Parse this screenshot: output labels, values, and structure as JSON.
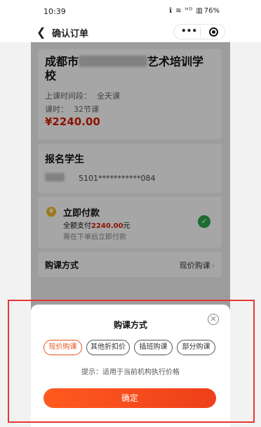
{
  "status_bar": {
    "time": "10:39",
    "icons": "ℹ ≋ ᴴᴰ ▥",
    "battery": "76%"
  },
  "nav": {
    "title": "确认订单",
    "more_icon": "more-icon",
    "target_icon": "target-icon"
  },
  "order": {
    "school_name_prefix": "成都市",
    "school_name_suffix": "艺术培训学校",
    "time_label": "上课时间段：",
    "time_value": "全天课",
    "hours_label": "课时：",
    "hours_value": "32节课",
    "price": "¥2240.00"
  },
  "student": {
    "section_title": "报名学生",
    "id_number": "5101***********084"
  },
  "payment": {
    "title": "立即付款",
    "line_prefix": "全额支付",
    "amount": "2240.00",
    "unit": "元",
    "note": "需在下单后立即付款"
  },
  "purchase": {
    "label": "购课方式",
    "value": "现价购课"
  },
  "sheet": {
    "title": "购课方式",
    "options": [
      "现价购课",
      "其他折扣价",
      "插班购课",
      "部分购课"
    ],
    "hint": "提示：适用于当前机构执行价格",
    "confirm_label": "确定"
  },
  "colors": {
    "accent": "#e8541c",
    "price_red": "#d81e06",
    "success_green": "#2aa84a",
    "highlight_frame": "#e53935"
  }
}
